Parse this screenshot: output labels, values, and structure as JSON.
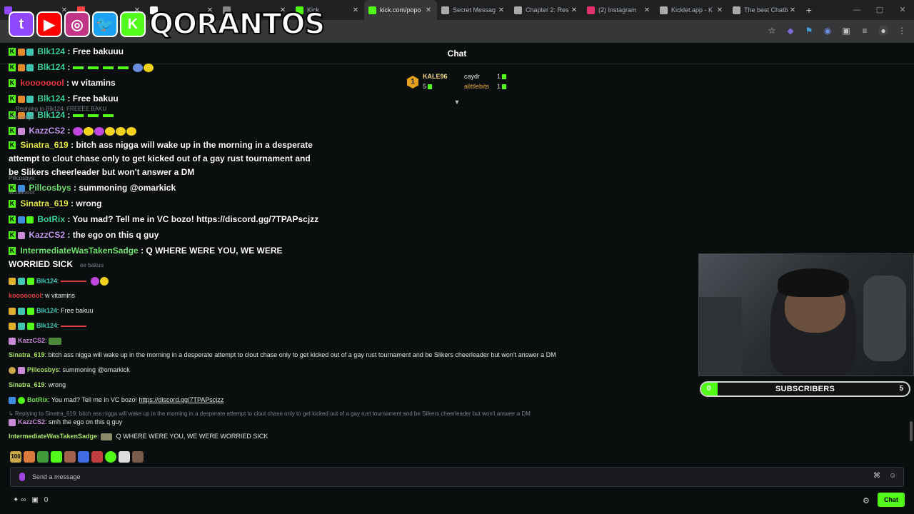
{
  "browser": {
    "tabs": [
      {
        "title": "",
        "color": "#9146ff",
        "active": false
      },
      {
        "title": "",
        "color": "#ff4444",
        "active": false
      },
      {
        "title": "",
        "color": "#ffffff",
        "active": false
      },
      {
        "title": "",
        "color": "#888888",
        "active": false
      },
      {
        "title": "Kick",
        "color": "#53fc18",
        "active": false
      },
      {
        "title": "kick.com/popo",
        "color": "#53fc18",
        "active": true
      },
      {
        "title": "Secret Messag",
        "color": "#aaaaaa",
        "active": false
      },
      {
        "title": "Chapter 2: Res",
        "color": "#aaaaaa",
        "active": false
      },
      {
        "title": "(2) Instagram",
        "color": "#e1306c",
        "active": false
      },
      {
        "title": "Kicklet.app - K",
        "color": "#aaaaaa",
        "active": false
      },
      {
        "title": "The best Chatb",
        "color": "#aaaaaa",
        "active": false
      }
    ]
  },
  "overlay": {
    "brand_text": "QORANTOS",
    "icons": [
      {
        "name": "twitch-icon",
        "glyph": "t",
        "color": "#9146ff"
      },
      {
        "name": "youtube-icon",
        "glyph": "▶",
        "color": "#ff0000"
      },
      {
        "name": "instagram-icon",
        "glyph": "◎",
        "color": "#c13584"
      },
      {
        "name": "twitter-icon",
        "glyph": "🐦",
        "color": "#1da1f2"
      },
      {
        "name": "kick-icon",
        "glyph": "K",
        "color": "#53fc18"
      }
    ]
  },
  "chat": {
    "title": "Chat",
    "leaderboard": {
      "rank": "1",
      "first_name": "KALE96",
      "first_count": "5",
      "second_name": "caydr",
      "second_count": "1",
      "third_name": "alittlebits",
      "third_count": "1"
    }
  },
  "overlay_chat": [
    {
      "user": "Blk124",
      "sep": " : ",
      "text": "Free bakuuu"
    },
    {
      "user": "Blk124",
      "sep": " : ",
      "text": ""
    },
    {
      "user": "koooooool",
      "sep": " : ",
      "text": "w vitamins"
    },
    {
      "user": "Blk124",
      "sep": " : ",
      "text": "Free bakuu"
    },
    {
      "user": "Blk124",
      "sep": " : ",
      "text": ""
    },
    {
      "user": "KazzCS2",
      "sep": " : ",
      "text": ""
    },
    {
      "user": "Sinatra_619",
      "sep": " : ",
      "text": "bitch ass nigga will wake up in the morning in a desperate attempt to clout chase only to get kicked out of a gay rust tournament and be Slikers cheerleader but won't answer a DM"
    },
    {
      "user": "Pillcosbys",
      "sep": " : ",
      "text": "summoning @omarkick"
    },
    {
      "user": "Sinatra_619",
      "sep": " : ",
      "text": "wrong"
    },
    {
      "user": "BotRix",
      "sep": " : ",
      "text": "You mad? Tell me in VC bozo! https://discord.gg/7TPAPscjzz"
    },
    {
      "user": "KazzCS2",
      "sep": " : ",
      "text": "the ego on this q guy"
    },
    {
      "user": "IntermediateWasTakenSadge",
      "sep": " : ",
      "text": "Q WHERE WERE YOU, WE WERE WORRIED SICK"
    }
  ],
  "overlay_ghosts": {
    "reply1": "Replying to Blk124: FREEEE BAKU",
    "ghost_a": "Pillcosbys:",
    "ghost_b": "Pillcosbys:",
    "ghost_c": "lactalloool:",
    "ghost_d": "ee bakuu"
  },
  "messages": [
    {
      "user": "Blk124",
      "text": ""
    },
    {
      "user": "koooooool",
      "text": "w vitamins"
    },
    {
      "user": "Blk124",
      "text": "Free bakuu"
    },
    {
      "user": "Blk124",
      "text": ""
    },
    {
      "user": "KazzCS2",
      "text": ""
    },
    {
      "user": "Sinatra_619",
      "text": "bitch ass nigga will wake up in the morning in a desperate attempt to clout chase only to get kicked out of a gay rust tournament and be Slikers cheerleader but won't answer a DM"
    },
    {
      "user": "Pillcosbys",
      "text": "summoning @omarkick"
    },
    {
      "user": "Sinatra_619",
      "text": "wrong"
    },
    {
      "user": "BotRix",
      "text": "You mad? Tell me in VC bozo! ",
      "link": "https://discord.gg/7TPAPscjzz"
    },
    {
      "reply": "Replying to Sinatra_619: bitch ass nigga will wake up in the morning in a desperate attempt to clout chase only to get kicked out of a gay rust tournament and be Slikers cheerleader but won't answer a DM"
    },
    {
      "user": "KazzCS2",
      "text": "smh the ego on this q guy"
    },
    {
      "user": "IntermediateWasTakenSadge",
      "text": "Q WHERE WERE YOU, WE WERE WORRIED SICK"
    }
  ],
  "subscribers": {
    "label": "SUBSCRIBERS",
    "current": "0",
    "goal": "5",
    "progress_fraction": 0.08
  },
  "input": {
    "placeholder": "Send a message",
    "emote_label": "100"
  },
  "bottom": {
    "viewers_icon": "∞",
    "gift_count": "0",
    "chat_button": "Chat"
  }
}
